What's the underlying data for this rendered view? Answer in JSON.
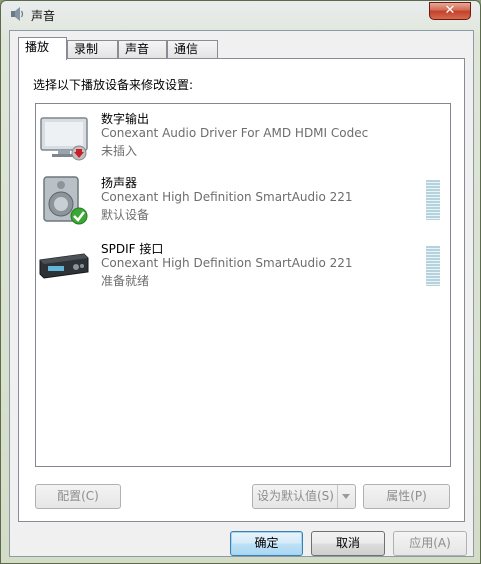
{
  "window": {
    "title": "声音",
    "close_label": "✕"
  },
  "tabs": [
    {
      "label": "播放",
      "active": true
    },
    {
      "label": "录制",
      "active": false
    },
    {
      "label": "声音",
      "active": false
    },
    {
      "label": "通信",
      "active": false
    }
  ],
  "panel": {
    "instruction": "选择以下播放设备来修改设置:"
  },
  "devices": [
    {
      "name": "数字输出",
      "driver": "Conexant Audio Driver For AMD HDMI Codec",
      "status": "未插入",
      "icon": "hdmi-monitor-icon",
      "badge": "unplugged-arrow-icon"
    },
    {
      "name": "扬声器",
      "driver": "Conexant High Definition SmartAudio 221",
      "status": "默认设备",
      "icon": "speaker-icon",
      "badge": "default-check-icon"
    },
    {
      "name": "SPDIF 接口",
      "driver": "Conexant High Definition SmartAudio 221",
      "status": "准备就绪",
      "icon": "spdif-receiver-icon"
    }
  ],
  "buttons": {
    "configure": "配置(C)",
    "set_default": "设为默认值(S)",
    "properties": "属性(P)",
    "ok": "确定",
    "cancel": "取消",
    "apply": "应用(A)"
  },
  "colors": {
    "close_button": "#c2402a",
    "default_check": "#3aa832",
    "meter": "#b5d3dc"
  }
}
